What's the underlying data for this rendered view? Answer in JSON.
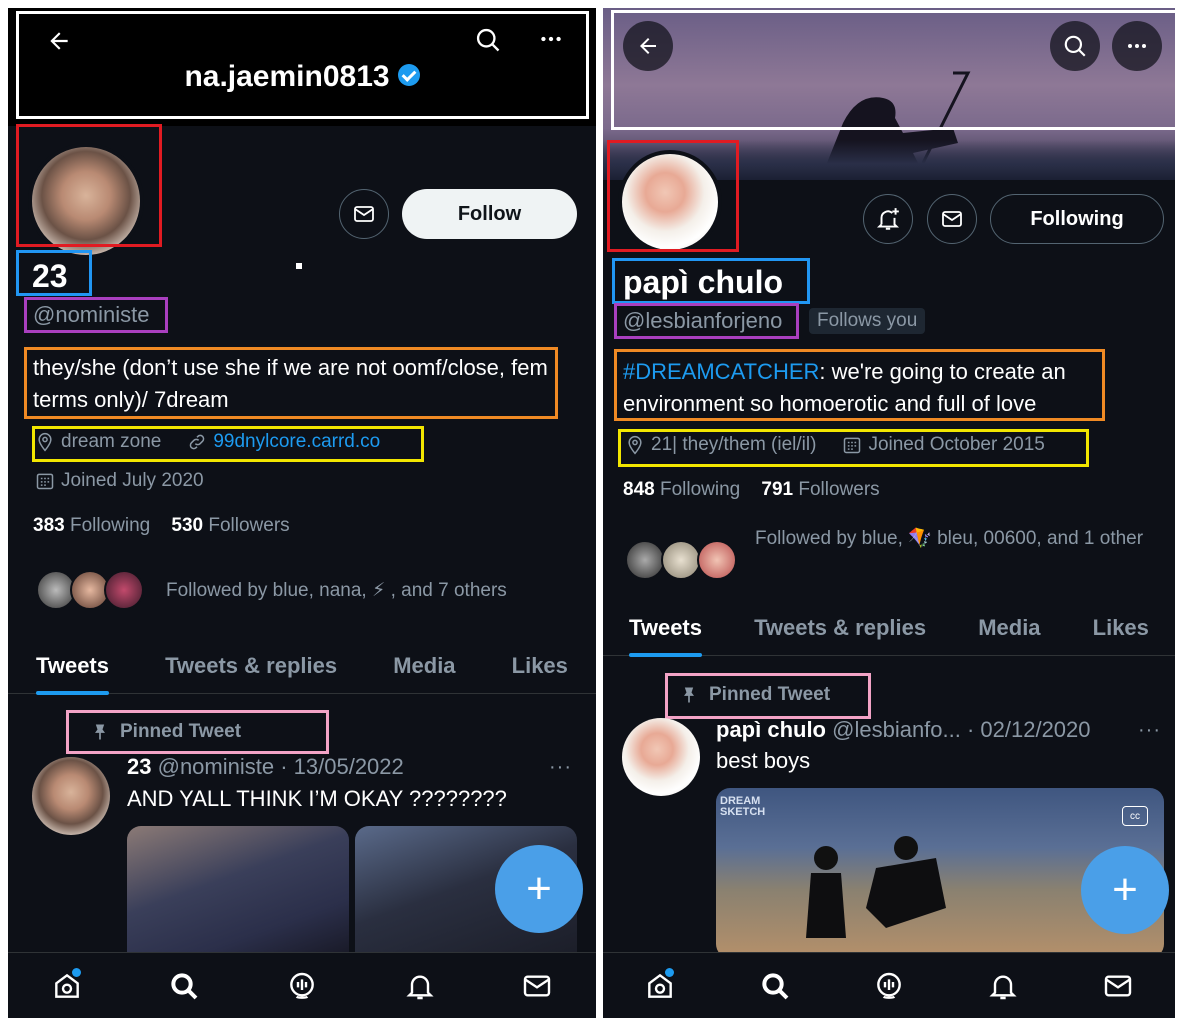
{
  "left": {
    "header": {
      "title": "na.jaemin0813"
    },
    "profile": {
      "name": "23",
      "handle": "@noministe",
      "bio": "they/she (don’t use she if we are not oomf/close, fem terms only)/ 7dream",
      "location": "dream zone",
      "website": "99dnylcore.carrd.co",
      "joined": "Joined July 2020",
      "following_count": "383",
      "following_label": "Following",
      "followers_count": "530",
      "followers_label": "Followers",
      "followed_by": "Followed by blue, nana, ⚡ , and 7 others",
      "follow_label": "Follow"
    },
    "tabs": [
      "Tweets",
      "Tweets & replies",
      "Media",
      "Likes"
    ],
    "pinned_label": "Pinned Tweet",
    "tweet": {
      "name": "23",
      "meta": "@noministe · 13/05/2022",
      "text": "AND YALL THINK I’M OKAY ????????",
      "more": "···"
    },
    "fab": "+"
  },
  "right": {
    "profile": {
      "name": "papì chulo",
      "handle": "@lesbianforjeno",
      "follows_you": "Follows you",
      "bio_hashtag": "#DREAMCATCHER",
      "bio_rest": ": we're going to create an environment so homoerotic and full of love",
      "location": "21| they/them (iel/il)",
      "joined": "Joined October 2015",
      "following_count": "848",
      "following_label": "Following",
      "followers_count": "791",
      "followers_label": "Followers",
      "followed_by": "Followed by blue, 🪁 bleu, 00600, and 1 other",
      "following_btn": "Following"
    },
    "tabs": [
      "Tweets",
      "Tweets & replies",
      "Media",
      "Likes"
    ],
    "pinned_label": "Pinned Tweet",
    "tweet": {
      "name": "papì chulo",
      "meta": "@lesbianfo... · 02/12/2020",
      "text": "best boys",
      "more": "···",
      "media_text": "DREAM SKETCH"
    },
    "fab": "+"
  },
  "colors": {
    "accent": "#1d9bf0",
    "background": "#0d1017",
    "annotation_white": "#ffffff",
    "annotation_red": "#e11b22",
    "annotation_blue": "#2196f3",
    "annotation_purple": "#a93fbf",
    "annotation_orange": "#f08a24",
    "annotation_yellow": "#f2e600",
    "annotation_pink": "#f2a3c6"
  },
  "icons": [
    "back-arrow-icon",
    "search-icon",
    "more-icon",
    "verified-icon",
    "mail-icon",
    "bell-plus-icon",
    "location-icon",
    "link-icon",
    "calendar-icon",
    "pin-icon",
    "home-icon",
    "spaces-icon",
    "notifications-icon",
    "messages-icon",
    "captions-icon"
  ]
}
